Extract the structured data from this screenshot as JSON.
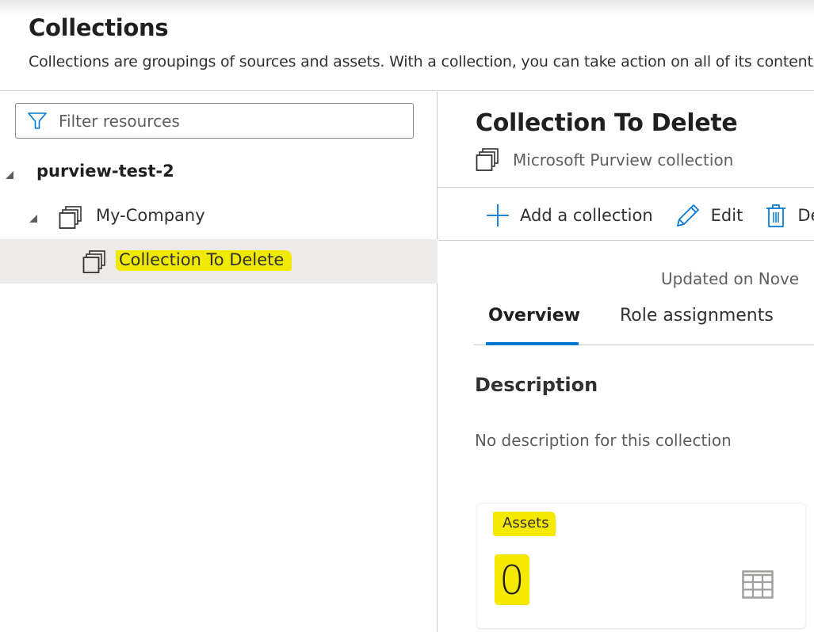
{
  "header": {
    "title": "Collections",
    "subtitle": "Collections are groupings of sources and assets. With a collection, you can take action on all of its contents"
  },
  "left_panel": {
    "filter": {
      "placeholder": "Filter resources",
      "value": "",
      "icon": "filter-icon"
    },
    "tree": [
      {
        "label": "purview-test-2",
        "level": 0,
        "expanded": true,
        "icon": null,
        "selected": false
      },
      {
        "label": "My-Company",
        "level": 1,
        "expanded": true,
        "icon": "collection-icon",
        "selected": false
      },
      {
        "label": "Collection To Delete",
        "level": 2,
        "expanded": false,
        "icon": "collection-icon",
        "selected": true,
        "highlighted": true
      }
    ]
  },
  "detail": {
    "title": "Collection To Delete",
    "type_label": "Microsoft Purview collection",
    "type_icon": "collection-icon",
    "toolbar": {
      "add_label": "Add a collection",
      "add_icon": "plus-icon",
      "edit_label": "Edit",
      "edit_icon": "pencil-icon",
      "delete_label": "Delete",
      "delete_icon": "trash-icon"
    },
    "updated_text": "Updated on Nove",
    "tabs": [
      {
        "label": "Overview",
        "active": true
      },
      {
        "label": "Role assignments",
        "active": false
      }
    ],
    "description_heading": "Description",
    "description_text": "No description for this collection",
    "assets_card": {
      "label": "Assets",
      "count": "0",
      "icon": "table-icon"
    }
  },
  "colors": {
    "accent": "#0078d4",
    "highlight": "#f5e900",
    "selected_row": "#edebe9",
    "text_primary": "#323130",
    "text_secondary": "#605e5c"
  }
}
